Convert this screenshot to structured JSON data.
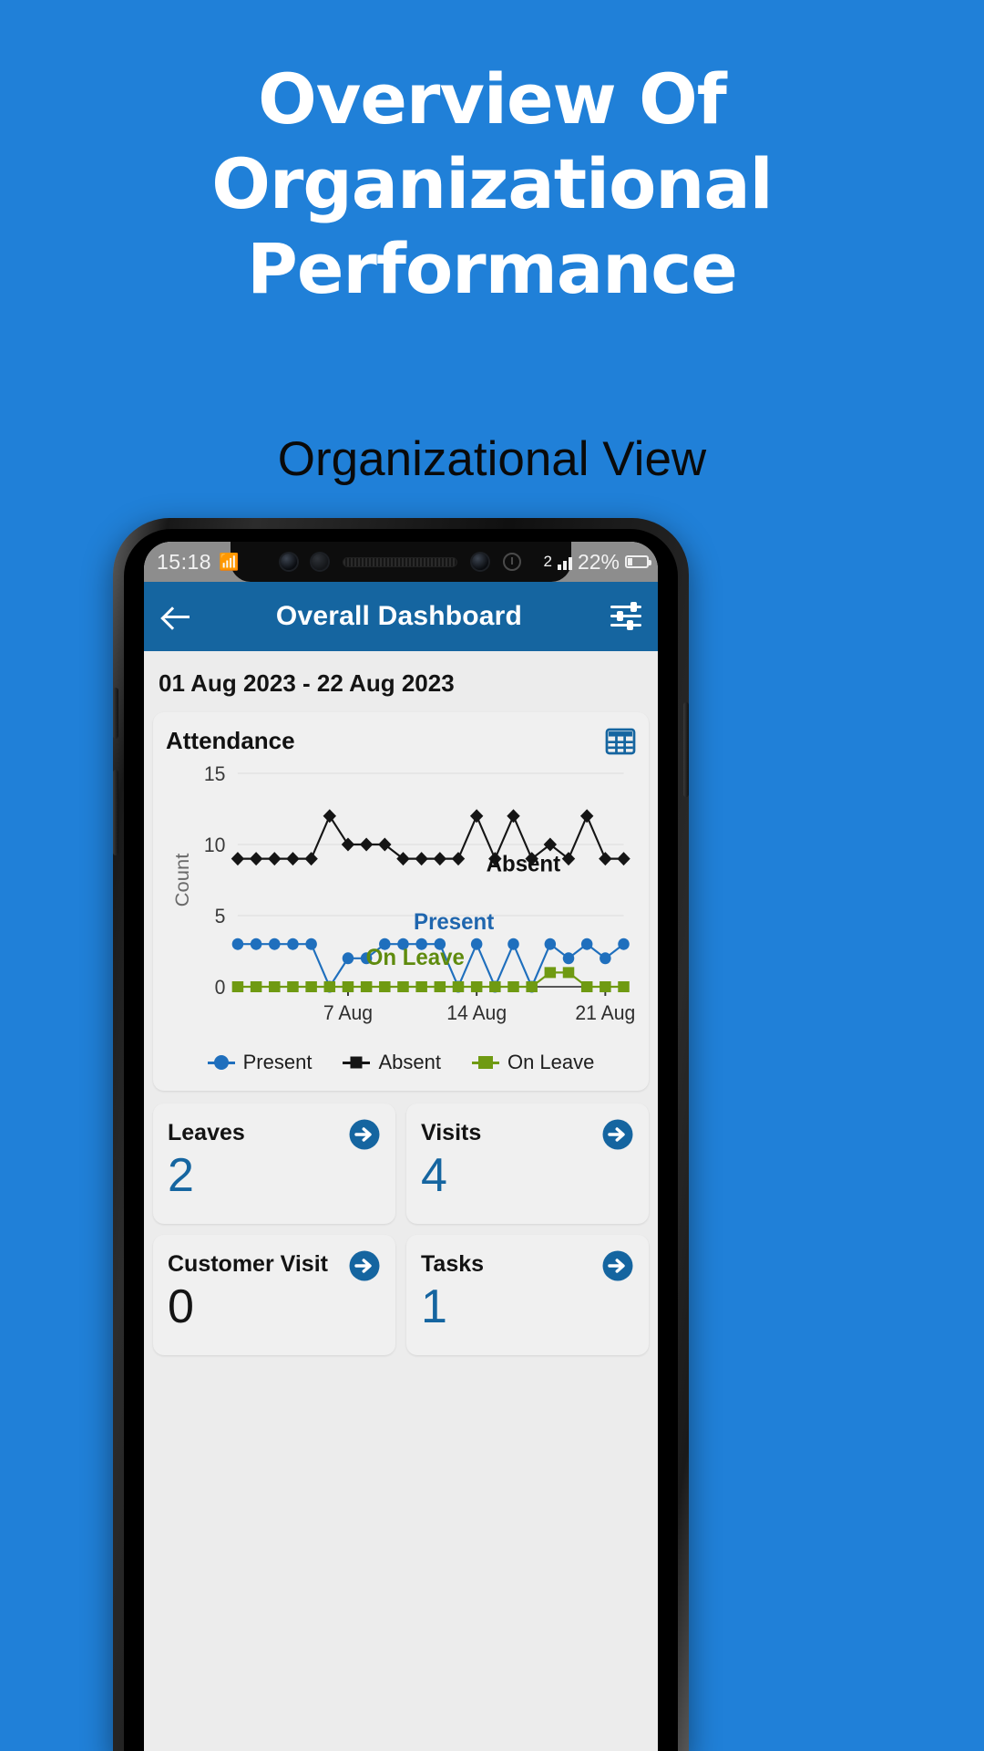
{
  "poster": {
    "background_color": "#2080d8",
    "headline_lines": [
      "Overview Of",
      "Organizational",
      "Performance"
    ],
    "subhead": "Organizational View"
  },
  "status_bar": {
    "time": "15:18",
    "bluetooth_icon": "bluetooth-icon",
    "network_label": "2",
    "battery_percent": "22%",
    "battery_level": 22
  },
  "app_bar": {
    "back_icon": "back-arrow-icon",
    "title": "Overall Dashboard",
    "filter_icon": "filter-sliders-icon"
  },
  "date_range": "01 Aug 2023 - 22 Aug 2023",
  "attendance_card": {
    "title": "Attendance",
    "table_icon": "table-grid-icon"
  },
  "chart_data": {
    "type": "line",
    "title": "Attendance",
    "xlabel": "",
    "ylabel": "Count",
    "ylim": [
      0,
      15
    ],
    "yticks": [
      0,
      5,
      10,
      15
    ],
    "grid": true,
    "legend_position": "bottom",
    "x": [
      "1 Aug",
      "2 Aug",
      "3 Aug",
      "4 Aug",
      "5 Aug",
      "6 Aug",
      "7 Aug",
      "8 Aug",
      "9 Aug",
      "10 Aug",
      "11 Aug",
      "12 Aug",
      "13 Aug",
      "14 Aug",
      "15 Aug",
      "16 Aug",
      "17 Aug",
      "18 Aug",
      "19 Aug",
      "20 Aug",
      "21 Aug",
      "22 Aug"
    ],
    "xtick_labels": [
      "7 Aug",
      "14 Aug",
      "21 Aug"
    ],
    "xtick_indices": [
      6,
      13,
      20
    ],
    "annotations": [
      {
        "text": "Absent",
        "series": "Absent",
        "color": "#111111"
      },
      {
        "text": "Present",
        "series": "Present",
        "color": "#1f66ae"
      },
      {
        "text": "On Leave",
        "series": "On Leave",
        "color": "#5f8b0e"
      }
    ],
    "series": [
      {
        "name": "Present",
        "color": "#1f6fbd",
        "marker": "circle",
        "values": [
          3,
          3,
          3,
          3,
          3,
          0,
          2,
          2,
          3,
          3,
          3,
          3,
          0,
          3,
          0,
          3,
          0,
          3,
          2,
          3,
          2,
          3
        ]
      },
      {
        "name": "Absent",
        "color": "#151515",
        "marker": "diamond",
        "values": [
          9,
          9,
          9,
          9,
          9,
          12,
          10,
          10,
          10,
          9,
          9,
          9,
          9,
          12,
          9,
          12,
          9,
          10,
          9,
          12,
          9,
          9
        ]
      },
      {
        "name": "On Leave",
        "color": "#6f9a12",
        "marker": "square",
        "values": [
          0,
          0,
          0,
          0,
          0,
          0,
          0,
          0,
          0,
          0,
          0,
          0,
          0,
          0,
          0,
          0,
          0,
          1,
          1,
          0,
          0,
          0
        ]
      }
    ],
    "legend": [
      {
        "label": "Present",
        "color": "#1f6fbd",
        "marker": "circle"
      },
      {
        "label": "Absent",
        "color": "#151515",
        "marker": "diamond"
      },
      {
        "label": "On Leave",
        "color": "#6f9a12",
        "marker": "square"
      }
    ]
  },
  "metrics": [
    {
      "label": "Leaves",
      "value": "2",
      "value_color": "#1565a0",
      "arrow_icon": "arrow-circle-right-icon"
    },
    {
      "label": "Visits",
      "value": "4",
      "value_color": "#1565a0",
      "arrow_icon": "arrow-circle-right-icon"
    },
    {
      "label": "Customer Visit",
      "value": "0",
      "value_color": "#141414",
      "arrow_icon": "arrow-circle-right-icon"
    },
    {
      "label": "Tasks",
      "value": "1",
      "value_color": "#1565a0",
      "arrow_icon": "arrow-circle-right-icon"
    }
  ],
  "colors": {
    "brand_blue": "#2080d8",
    "appbar_blue": "#1565a0",
    "accent": "#1565a0"
  }
}
